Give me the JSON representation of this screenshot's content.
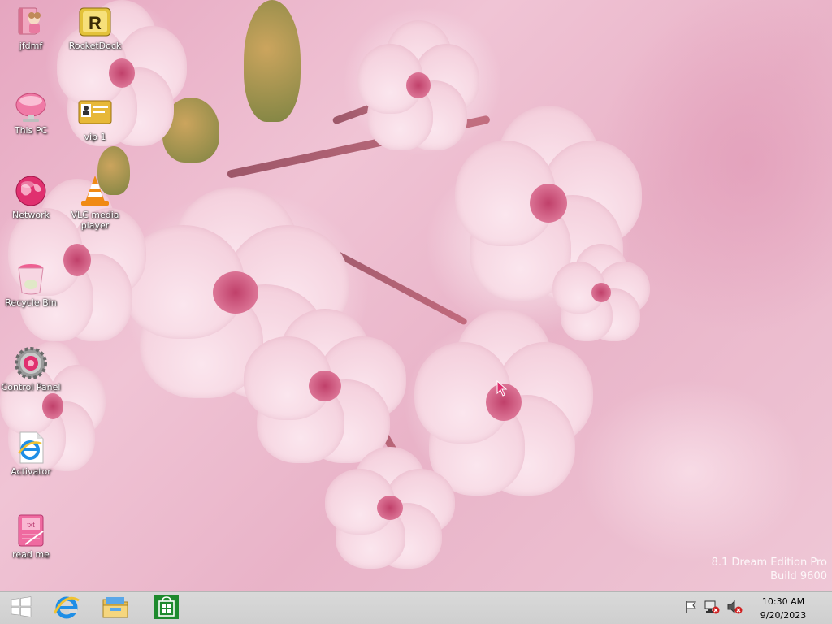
{
  "desktop": {
    "icons": [
      {
        "label": "jfdmf",
        "icon": "user-folder-icon"
      },
      {
        "label": "RocketDock",
        "icon": "rocketdock-icon"
      },
      {
        "label": "This PC",
        "icon": "this-pc-icon"
      },
      {
        "label": "vip 1",
        "icon": "id-card-icon"
      },
      {
        "label": "Network",
        "icon": "network-globe-icon"
      },
      {
        "label": "VLC media player",
        "icon": "vlc-cone-icon"
      },
      {
        "label": "Recycle Bin",
        "icon": "recycle-bin-icon"
      },
      {
        "label": "Control Panel",
        "icon": "control-panel-gear-icon"
      },
      {
        "label": "Activator",
        "icon": "internet-explorer-file-icon"
      },
      {
        "label": "read me",
        "icon": "text-notebook-icon"
      }
    ],
    "watermark": {
      "line1": "8.1 Dream Edition Pro",
      "line2": "Build 9600"
    }
  },
  "taskbar": {
    "pinned": [
      {
        "name": "Start",
        "icon": "windows-logo-icon"
      },
      {
        "name": "Internet Explorer",
        "icon": "internet-explorer-icon"
      },
      {
        "name": "File Explorer",
        "icon": "file-explorer-folder-icon"
      },
      {
        "name": "Store",
        "icon": "store-bag-icon"
      }
    ],
    "tray_icons": [
      "action-center-flag-icon",
      "network-disconnected-icon",
      "volume-muted-icon"
    ],
    "clock": {
      "time": "10:30 AM",
      "date": "9/20/2023"
    }
  },
  "colors": {
    "taskbar_bg": "#d4d4d4",
    "accent_start": "#ffffff",
    "store_green": "#1e8a2e",
    "desktop_pink": "#efc3d4"
  }
}
